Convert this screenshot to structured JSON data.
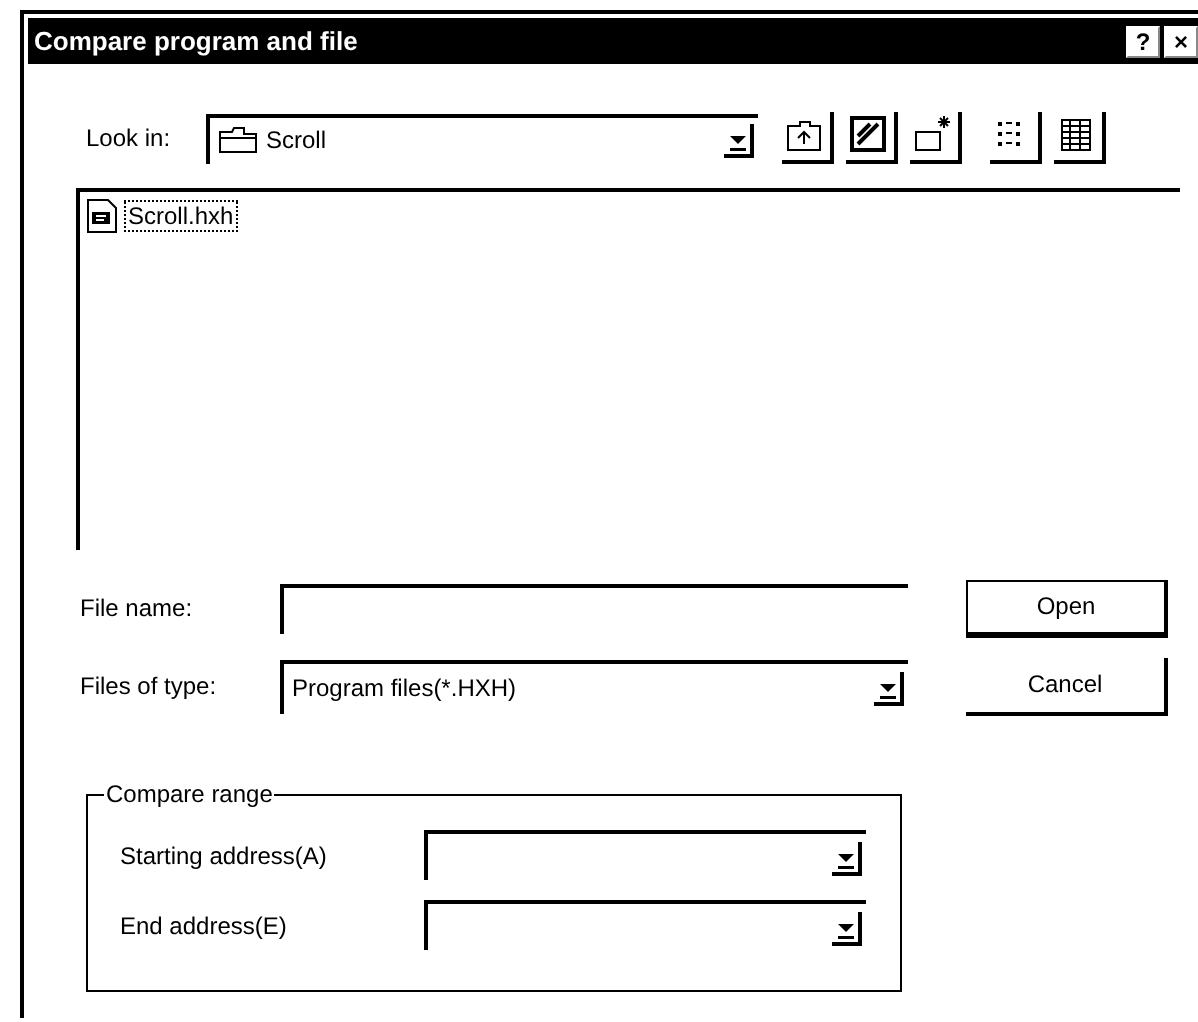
{
  "window": {
    "title": "Compare program and file",
    "title_buttons": [
      "?",
      "×"
    ]
  },
  "look_in": {
    "label": "Look in:",
    "value": "Scroll"
  },
  "files": [
    {
      "name": "Scroll.hxh",
      "selected": true
    }
  ],
  "file_name": {
    "label": "File name:"
  },
  "file_type": {
    "label": "Files of type:",
    "value": "Program files(*.HXH)"
  },
  "buttons": [
    "Open",
    "Cancel"
  ],
  "compare_range": {
    "title": "Compare range",
    "fields": [
      {
        "label": "Starting address(A)"
      },
      {
        "label": "End address(E)"
      }
    ]
  }
}
